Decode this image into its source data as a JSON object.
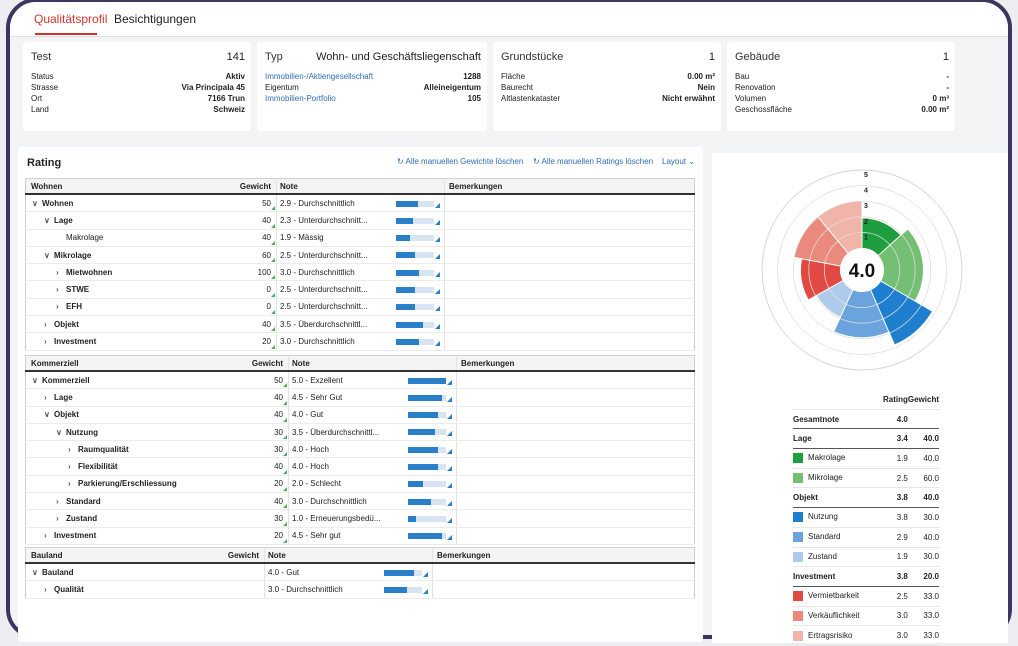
{
  "tabs": [
    {
      "label": "Qualitätsprofil"
    },
    {
      "label": "Besichtigungen"
    }
  ],
  "cards": {
    "test": {
      "title": "Test",
      "value": "141",
      "rows": [
        {
          "label": "Status",
          "value": "Aktiv"
        },
        {
          "label": "Strasse",
          "value": "Via Principala 45"
        },
        {
          "label": "Ort",
          "value": "7166 Trun"
        },
        {
          "label": "Land",
          "value": "Schweiz"
        }
      ]
    },
    "typ": {
      "title": "Typ",
      "value": "Wohn- und Geschäftsliegenschaft",
      "rows": [
        {
          "label": "Immobilien-/Aktiengesellschaft",
          "value": "1288"
        },
        {
          "label": "Eigentum",
          "value": "Alleineigentum"
        },
        {
          "label": "Immobilien-Portfolio",
          "value": "105"
        }
      ]
    },
    "grund": {
      "title": "Grundstücke",
      "value": "1",
      "rows": [
        {
          "label": "Fläche",
          "value": "0.00 m²"
        },
        {
          "label": "Baurecht",
          "value": "Nein"
        },
        {
          "label": "Altlastenkataster",
          "value": "Nicht erwähnt"
        }
      ]
    },
    "geb": {
      "title": "Gebäude",
      "value": "1",
      "rows": [
        {
          "label": "Bau",
          "value": "-"
        },
        {
          "label": "Renovation",
          "value": "-"
        },
        {
          "label": "Volumen",
          "value": "0 m³"
        },
        {
          "label": "Geschossfläche",
          "value": "0.00 m²"
        }
      ]
    }
  },
  "rating": {
    "title": "Rating",
    "actions": [
      "Alle manuellen Gewichte löschen",
      "Alle manuellen Ratings löschen",
      "Layout"
    ],
    "icons": {
      "refresh": "refresh-icon",
      "chevron": "chevron-down-icon"
    },
    "tables": [
      {
        "header": [
          "Wohnen",
          "Gewicht",
          "Note",
          "",
          "Bemerkungen"
        ],
        "rows": [
          {
            "label": "Wohnen",
            "indent": 1,
            "chev": "v",
            "bold": true,
            "weight": "50",
            "note": "2.9 - Durchschnittlich",
            "fill": 0.58
          },
          {
            "label": "Lage",
            "indent": 2,
            "chev": "v",
            "bold": true,
            "weight": "40",
            "note": "2.3 - Unterdurchschnitt...",
            "fill": 0.46
          },
          {
            "label": "Makrolage",
            "indent": 3,
            "chev": "",
            "bold": false,
            "weight": "40",
            "note": "1.9 - Mässig",
            "fill": 0.38
          },
          {
            "label": "Mikrolage",
            "indent": 2,
            "chev": "v",
            "bold": true,
            "weight": "60",
            "note": "2.5 - Unterdurchschnitt...",
            "fill": 0.5
          },
          {
            "label": "Mietwohnen",
            "indent": 3,
            "chev": ">",
            "bold": true,
            "weight": "100",
            "note": "3.0 - Durchschnittlich",
            "fill": 0.6
          },
          {
            "label": "STWE",
            "indent": 3,
            "chev": ">",
            "bold": true,
            "weight": "0",
            "note": "2.5 - Unterdurchschnitt...",
            "fill": 0.5
          },
          {
            "label": "EFH",
            "indent": 3,
            "chev": ">",
            "bold": true,
            "weight": "0",
            "note": "2.5 - Unterdurchschnitt...",
            "fill": 0.5
          },
          {
            "label": "Objekt",
            "indent": 2,
            "chev": ">",
            "bold": true,
            "weight": "40",
            "note": "3.5 - Überdurchschnittl...",
            "fill": 0.7
          },
          {
            "label": "Investment",
            "indent": 2,
            "chev": ">",
            "bold": true,
            "weight": "20",
            "note": "3.0 - Durchschnittlich",
            "fill": 0.6
          }
        ]
      },
      {
        "header": [
          "Kommerziell",
          "Gewicht",
          "Note",
          "",
          "Bemerkungen"
        ],
        "rows": [
          {
            "label": "Kommerziell",
            "indent": 1,
            "chev": "v",
            "bold": true,
            "weight": "50",
            "note": "5.0 - Exzellent",
            "fill": 1.0
          },
          {
            "label": "Lage",
            "indent": 2,
            "chev": ">",
            "bold": true,
            "weight": "40",
            "note": "4.5 - Sehr Gut",
            "fill": 0.9
          },
          {
            "label": "Objekt",
            "indent": 2,
            "chev": "v",
            "bold": true,
            "weight": "40",
            "note": "4.0 - Gut",
            "fill": 0.8
          },
          {
            "label": "Nutzung",
            "indent": 3,
            "chev": "v",
            "bold": true,
            "weight": "30",
            "note": "3.5 - Überdurchschnittl...",
            "fill": 0.7
          },
          {
            "label": "Raumqualität",
            "indent": 4,
            "chev": ">",
            "bold": true,
            "weight": "30",
            "note": "4.0 - Hoch",
            "fill": 0.8
          },
          {
            "label": "Flexibilität",
            "indent": 4,
            "chev": ">",
            "bold": true,
            "weight": "40",
            "note": "4.0 - Hoch",
            "fill": 0.8
          },
          {
            "label": "Parkierung/Erschliessung",
            "indent": 4,
            "chev": ">",
            "bold": true,
            "weight": "20",
            "note": "2.0 - Schlecht",
            "fill": 0.4
          },
          {
            "label": "Standard",
            "indent": 3,
            "chev": ">",
            "bold": true,
            "weight": "40",
            "note": "3.0 - Durchschnittlich",
            "fill": 0.6
          },
          {
            "label": "Zustand",
            "indent": 3,
            "chev": ">",
            "bold": true,
            "weight": "30",
            "note": "1.0 - Erneuerungsbedü...",
            "fill": 0.2
          },
          {
            "label": "Investment",
            "indent": 2,
            "chev": ">",
            "bold": true,
            "weight": "20",
            "note": "4.5 - Sehr gut",
            "fill": 0.9
          }
        ]
      },
      {
        "header": [
          "Bauland",
          "Gewicht",
          "Note",
          "",
          "Bemerkungen"
        ],
        "rows": [
          {
            "label": "Bauland",
            "indent": 1,
            "chev": "v",
            "bold": true,
            "weight": "",
            "note": "4.0 - Gut",
            "fill": 0.8
          },
          {
            "label": "Qualität",
            "indent": 2,
            "chev": ">",
            "bold": true,
            "weight": "",
            "note": "3.0 - Durchschnittlich",
            "fill": 0.6
          }
        ]
      }
    ]
  },
  "chart_data": {
    "type": "polar-area",
    "center_value": "4.0",
    "radial_ticks": [
      "1",
      "2",
      "3",
      "4",
      "5"
    ],
    "rmax": 5,
    "segments": [
      {
        "name": "Makrolage",
        "value": 1.9,
        "weight": 40.0,
        "color": "#1e9e3e"
      },
      {
        "name": "Mikrolage",
        "value": 2.5,
        "weight": 60.0,
        "color": "#74bf74"
      },
      {
        "name": "Nutzung",
        "value": 3.8,
        "weight": 30.0,
        "color": "#1f7fcf"
      },
      {
        "name": "Standard",
        "value": 2.9,
        "weight": 40.0,
        "color": "#6ba4dc"
      },
      {
        "name": "Zustand",
        "value": 1.9,
        "weight": 30.0,
        "color": "#aecbeb"
      },
      {
        "name": "Vermietbarkeit",
        "value": 2.5,
        "weight": 33.0,
        "color": "#e04a43"
      },
      {
        "name": "Verkäuflichkeit",
        "value": 3.0,
        "weight": 33.0,
        "color": "#e98a7c"
      },
      {
        "name": "Ertragsrisiko",
        "value": 3.0,
        "weight": 33.0,
        "color": "#f1b4a8"
      }
    ],
    "group_weights": {
      "Lage": 40.0,
      "Objekt": 40.0,
      "Investment": 20.0
    }
  },
  "legend": {
    "headers": [
      "",
      "Rating",
      "Gewicht"
    ],
    "rows": [
      {
        "type": "total",
        "label": "Gesamtnote",
        "rating": "4.0",
        "weight": ""
      },
      {
        "type": "grp",
        "label": "Lage",
        "rating": "3.4",
        "weight": "40.0"
      },
      {
        "type": "item",
        "label": "Makrolage",
        "rating": "1.9",
        "weight": "40.0",
        "color": "#1e9e3e"
      },
      {
        "type": "item",
        "label": "Mikrolage",
        "rating": "2.5",
        "weight": "60.0",
        "color": "#74bf74"
      },
      {
        "type": "grp",
        "label": "Objekt",
        "rating": "3.8",
        "weight": "40.0"
      },
      {
        "type": "item",
        "label": "Nutzung",
        "rating": "3.8",
        "weight": "30.0",
        "color": "#1f7fcf"
      },
      {
        "type": "item",
        "label": "Standard",
        "rating": "2.9",
        "weight": "40.0",
        "color": "#6ba4dc"
      },
      {
        "type": "item",
        "label": "Zustand",
        "rating": "1.9",
        "weight": "30.0",
        "color": "#aecbeb"
      },
      {
        "type": "grp",
        "label": "Investment",
        "rating": "3.8",
        "weight": "20.0"
      },
      {
        "type": "item",
        "label": "Vermietbarkeit",
        "rating": "2.5",
        "weight": "33.0",
        "color": "#e04a43"
      },
      {
        "type": "item",
        "label": "Verkäuflichkeit",
        "rating": "3.0",
        "weight": "33.0",
        "color": "#e98a7c"
      },
      {
        "type": "item",
        "label": "Ertragsrisiko",
        "rating": "3.0",
        "weight": "33.0",
        "color": "#f1b4a8"
      }
    ]
  }
}
